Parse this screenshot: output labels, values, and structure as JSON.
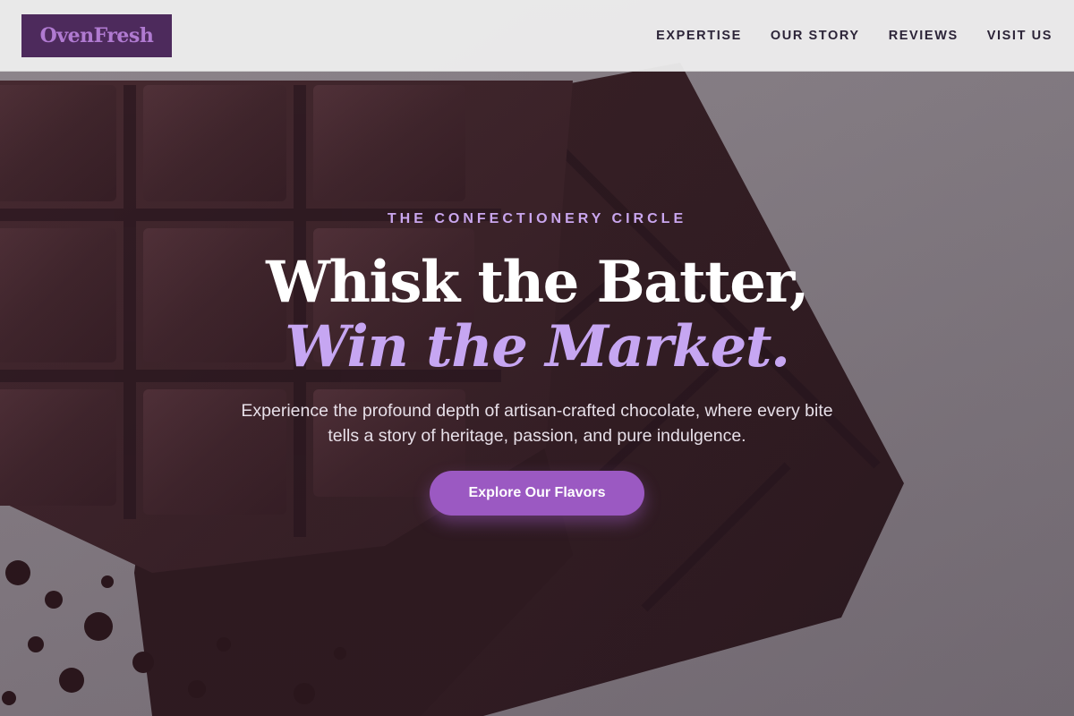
{
  "brand": {
    "logo_text": "OvenFresh"
  },
  "nav": {
    "items": [
      {
        "label": "EXPERTISE"
      },
      {
        "label": "OUR STORY"
      },
      {
        "label": "REVIEWS"
      },
      {
        "label": "VISIT US"
      }
    ]
  },
  "hero": {
    "eyebrow": "THE CONFECTIONERY CIRCLE",
    "headline_line1": "Whisk the Batter,",
    "headline_line2": "Win the Market.",
    "subtext": "Experience the profound depth of artisan-crafted chocolate, where every bite tells a story of heritage, passion, and pure indulgence.",
    "cta_label": "Explore Our Flavors"
  },
  "colors": {
    "brand_purple": "#4d2a5c",
    "accent_lavender": "#c6a6f2",
    "cta_purple": "#9b59c2",
    "nav_text": "#2c2438",
    "chocolate": "#3b2328"
  }
}
